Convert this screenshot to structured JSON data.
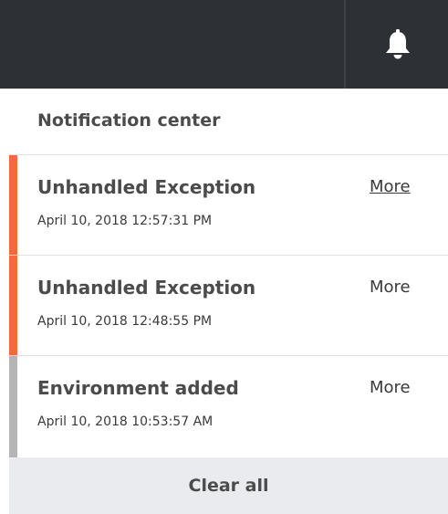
{
  "header": {
    "bell_icon": "bell-icon"
  },
  "panel": {
    "title": "Notification center",
    "notifications": [
      {
        "title": "Unhandled Exception",
        "time": "April 10, 2018 12:57:31 PM",
        "action": "More",
        "accent": "#f26b3a"
      },
      {
        "title": "Unhandled Exception",
        "time": "April 10, 2018 12:48:55 PM",
        "action": "More",
        "accent": "#f26b3a"
      },
      {
        "title": "Environment added",
        "time": "April 10, 2018 10:53:57 AM",
        "action": "More",
        "accent": "#b5b5b5"
      }
    ],
    "clear_all_label": "Clear all"
  },
  "colors": {
    "topbar_bg": "#2d3136",
    "error_accent": "#f26b3a",
    "info_accent": "#b5b5b5",
    "footer_bg": "#e9ebee"
  }
}
